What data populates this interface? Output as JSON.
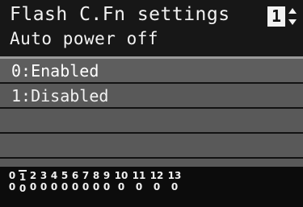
{
  "header": {
    "title": "Flash C.Fn settings",
    "subtitle": "Auto power off",
    "page_number": "1"
  },
  "options": [
    {
      "label": "0:Enabled"
    },
    {
      "label": "1:Disabled"
    },
    {
      "label": ""
    },
    {
      "label": ""
    },
    {
      "label": ""
    }
  ],
  "footer": {
    "functions": [
      {
        "number": "0",
        "value": "0"
      },
      {
        "number": "1",
        "value": "0"
      },
      {
        "number": "2",
        "value": "0"
      },
      {
        "number": "3",
        "value": "0"
      },
      {
        "number": "4",
        "value": "0"
      },
      {
        "number": "5",
        "value": "0"
      },
      {
        "number": "6",
        "value": "0"
      },
      {
        "number": "7",
        "value": "0"
      },
      {
        "number": "8",
        "value": "0"
      },
      {
        "number": "9",
        "value": "0"
      },
      {
        "number": "10",
        "value": "0"
      },
      {
        "number": "11",
        "value": "0"
      },
      {
        "number": "12",
        "value": "0"
      },
      {
        "number": "13",
        "value": "0"
      }
    ],
    "current_index": 1
  },
  "colors": {
    "background": "#111111",
    "row": "#595959",
    "text": "#f2f2f2"
  },
  "icons": {
    "spinner": "up-down-arrows-icon"
  }
}
